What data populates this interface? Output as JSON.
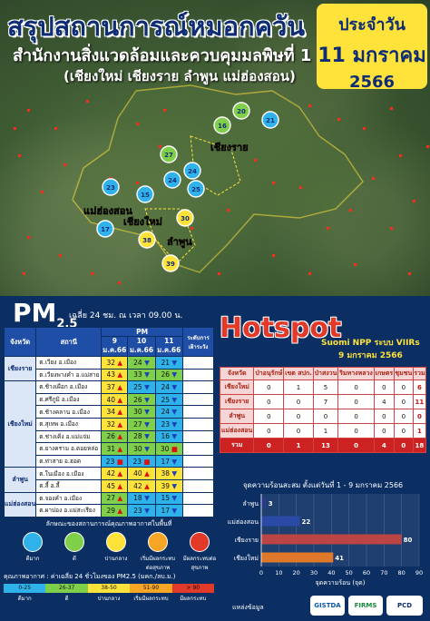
{
  "header": {
    "title": "สรุปสถานการณ์หมอกควัน",
    "office": "สำนักงานสิ่งแวดล้อมและควบคุมมลพิษที่ 1",
    "provinces_line": "(เชียงใหม่ เชียงราย ลำพูน แม่ฮ่องสอน)",
    "date_label": "ประจำวัน",
    "date_day": "11 มกราคม",
    "date_year": "2566"
  },
  "map": {
    "province_labels": [
      "เชียงราย",
      "แม่ฮ่องสอน",
      "เชียงใหม่",
      "ลำพูน"
    ],
    "stations": [
      {
        "value": "20",
        "color": "#7fcf4a"
      },
      {
        "value": "21",
        "color": "#2fb2ea"
      },
      {
        "value": "16",
        "color": "#7fcf4a"
      },
      {
        "value": "27",
        "color": "#7fcf4a"
      },
      {
        "value": "24",
        "color": "#2fb2ea"
      },
      {
        "value": "25",
        "color": "#2fb2ea"
      },
      {
        "value": "23",
        "color": "#2fb2ea"
      },
      {
        "value": "15",
        "color": "#2fb2ea"
      },
      {
        "value": "24",
        "color": "#2fb2ea"
      },
      {
        "value": "17",
        "color": "#2fb2ea"
      },
      {
        "value": "30",
        "color": "#ffe23a"
      },
      {
        "value": "38",
        "color": "#ffe23a"
      },
      {
        "value": "39",
        "color": "#ffe23a"
      }
    ]
  },
  "pm25": {
    "heading": "PM",
    "heading_sub": "2.5",
    "note": "เฉลี่ย 24 ชม. ณ เวลา 09.00 น.",
    "columns": {
      "province": "จังหวัด",
      "station": "สถานี",
      "pm": "PM",
      "d1": "9 ม.ค.66",
      "d2": "10 ม.ค.66",
      "d3": "11 ม.ค.66",
      "advice": "ระดับการ เฝ้าระวัง"
    },
    "groups": [
      {
        "province": "เชียงราย",
        "rows": [
          {
            "station": "ต.เวียง อ.เมือง",
            "v": [
              "32",
              "24",
              "21"
            ],
            "c": [
              "c-yellow",
              "c-green",
              "c-blue"
            ],
            "t": [
              "▲",
              "▼",
              "▼"
            ]
          },
          {
            "station": "ต.เวียงพางคำ อ.แม่สาย",
            "v": [
              "43",
              "33",
              "26"
            ],
            "c": [
              "c-yellow",
              "c-green",
              "c-green"
            ],
            "t": [
              "▲",
              "▼",
              "▼"
            ]
          }
        ]
      },
      {
        "province": "เชียงใหม่",
        "rows": [
          {
            "station": "ต.ช้างเผือก อ.เมือง",
            "v": [
              "37",
              "25",
              "24"
            ],
            "c": [
              "c-yellow",
              "c-blue",
              "c-blue"
            ],
            "t": [
              "▲",
              "▼",
              "▼"
            ]
          },
          {
            "station": "ต.ศรีภูมิ อ.เมือง",
            "v": [
              "40",
              "26",
              "25"
            ],
            "c": [
              "c-yellow",
              "c-green",
              "c-blue"
            ],
            "t": [
              "▲",
              "▼",
              "▼"
            ]
          },
          {
            "station": "ต.ช้างคลาน อ.เมือง",
            "v": [
              "34",
              "30",
              "24"
            ],
            "c": [
              "c-yellow",
              "c-green",
              "c-blue"
            ],
            "t": [
              "▲",
              "▼",
              "▼"
            ]
          },
          {
            "station": "ต.สุเทพ อ.เมือง",
            "v": [
              "32",
              "27",
              "23"
            ],
            "c": [
              "c-yellow",
              "c-green",
              "c-blue"
            ],
            "t": [
              "▲",
              "▼",
              "▼"
            ]
          },
          {
            "station": "ต.ช่างเคิ่ง อ.แม่แจ่ม",
            "v": [
              "26",
              "28",
              "16"
            ],
            "c": [
              "c-green",
              "c-green",
              "c-blue"
            ],
            "t": [
              "▲",
              "▼",
              "▼"
            ]
          },
          {
            "station": "ต.ยางคราม อ.ดอยหล่อ",
            "v": [
              "31",
              "30",
              "30"
            ],
            "c": [
              "c-green",
              "c-green",
              "c-green"
            ],
            "t": [
              "▲",
              "▼",
              "■"
            ]
          },
          {
            "station": "ต.ท่าสาย อ.ฮอด",
            "v": [
              "23",
              "23",
              "17"
            ],
            "c": [
              "c-blue",
              "c-blue",
              "c-blue"
            ],
            "t": [
              "■",
              "■",
              "▼"
            ]
          }
        ]
      },
      {
        "province": "ลำพูน",
        "rows": [
          {
            "station": "ต.ในเมือง อ.เมือง",
            "v": [
              "42",
              "40",
              "38"
            ],
            "c": [
              "c-yellow",
              "c-yellow",
              "c-yellow"
            ],
            "t": [
              "▲",
              "▲",
              "▼"
            ]
          },
          {
            "station": "ต.ลี้ อ.ลี้",
            "v": [
              "45",
              "42",
              "39"
            ],
            "c": [
              "c-yellow",
              "c-yellow",
              "c-yellow"
            ],
            "t": [
              "▲",
              "▲",
              "▼"
            ]
          }
        ]
      },
      {
        "province": "แม่ฮ่องสอน",
        "rows": [
          {
            "station": "ต.จองคำ อ.เมือง",
            "v": [
              "27",
              "18",
              "15"
            ],
            "c": [
              "c-green",
              "c-blue",
              "c-blue"
            ],
            "t": [
              "▲",
              "▼",
              "▼"
            ]
          },
          {
            "station": "ต.ผาบ่อง อ.แม่สะเรียง",
            "v": [
              "29",
              "23",
              "17"
            ],
            "c": [
              "c-green",
              "c-blue",
              "c-blue"
            ],
            "t": [
              "▲",
              "▼",
              "▼"
            ]
          }
        ]
      }
    ],
    "legend_title": "ลักษณะของสถานการณ์คุณภาพอากาศในพื้นที่",
    "legend_items": [
      {
        "label": "ดีมาก",
        "color": "#2fb2ea"
      },
      {
        "label": "ดี",
        "color": "#7fcf4a"
      },
      {
        "label": "ปานกลาง",
        "color": "#ffe23a"
      },
      {
        "label": "เริ่มมีผลกระทบต่อสุขภาพ",
        "color": "#f6a524"
      },
      {
        "label": "มีผลกระทบต่อสุขภาพ",
        "color": "#e23a2a"
      }
    ],
    "scale_title": "คุณภาพอากาศ : ค่าเฉลี่ย 24 ชั่วโมงของ PM2.5 (มคก./ลบ.ม.)",
    "scale_ranges": [
      "0-25",
      "26-37",
      "38-50",
      "51-90",
      "> 90"
    ],
    "scale_colors": [
      "#2fb2ea",
      "#7fcf4a",
      "#ffe23a",
      "#f6a524",
      "#e23a2a"
    ],
    "scale_labels": [
      "ดีมาก",
      "ดี",
      "ปานกลาง",
      "เริ่มมีผลกระทบ",
      "มีผลกระทบ"
    ]
  },
  "hotspot": {
    "title": "Hotspot",
    "source": "Suomi NPP ระบบ VIIRs",
    "date": "9 มกราคม 2566",
    "columns": [
      "จังหวัด",
      "ป่าอนุรักษ์",
      "เขต สปก.",
      "ป่าสงวน",
      "ริมทางหลวง",
      "เกษตร",
      "ชุมชน",
      "รวม"
    ],
    "rows": [
      {
        "province": "เชียงใหม่",
        "values": [
          "0",
          "1",
          "5",
          "0",
          "0",
          "0",
          "6"
        ]
      },
      {
        "province": "เชียงราย",
        "values": [
          "0",
          "0",
          "7",
          "0",
          "4",
          "0",
          "11"
        ]
      },
      {
        "province": "ลำพูน",
        "values": [
          "0",
          "0",
          "0",
          "0",
          "0",
          "0",
          "0"
        ]
      },
      {
        "province": "แม่ฮ่องสอน",
        "values": [
          "0",
          "0",
          "1",
          "0",
          "0",
          "0",
          "1"
        ]
      }
    ],
    "total": {
      "province": "รวม",
      "values": [
        "0",
        "1",
        "13",
        "0",
        "4",
        "0",
        "18"
      ]
    }
  },
  "chart_data": {
    "type": "bar",
    "orientation": "horizontal",
    "title": "จุดความร้อนสะสม ตั้งแต่วันที่ 1 - 9 มกราคม 2566",
    "xlabel": "จุดความร้อน (จุด)",
    "categories": [
      "ลำพูน",
      "แม่ฮ่องสอน",
      "เชียงราย",
      "เชียงใหม่"
    ],
    "values": [
      3,
      22,
      80,
      41
    ],
    "colors": [
      "#2a3a8a",
      "#2a4aa6",
      "#b44",
      "#e0782a"
    ],
    "xlim": [
      0,
      90
    ],
    "xticks": [
      "0",
      "10",
      "20",
      "30",
      "40",
      "50",
      "60",
      "70",
      "80",
      "90"
    ]
  },
  "footer": {
    "source_label": "แหล่งข้อมูล",
    "logos": [
      "GISTDA",
      "FIRMS",
      "PCD"
    ]
  }
}
